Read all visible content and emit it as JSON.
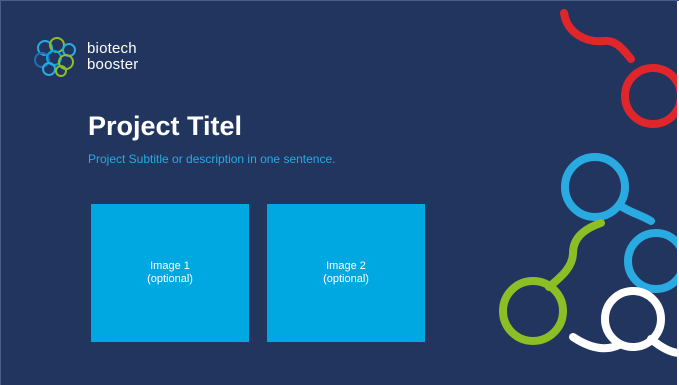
{
  "logo": {
    "line1": "biotech",
    "line2": "booster"
  },
  "title": "Project Titel",
  "subtitle": "Project Subtitle or description in one sentence.",
  "images": [
    {
      "line1": "Image 1",
      "line2": "(optional)"
    },
    {
      "line1": "Image 2",
      "line2": "(optional)"
    }
  ],
  "colors": {
    "background": "#21355f",
    "accent_blue": "#29abe2",
    "image_box": "#00a8e1",
    "red_molecule": "#e0262b",
    "green_molecule": "#8cbf26",
    "blue_molecule": "#29abe2",
    "white_molecule": "#ffffff"
  }
}
